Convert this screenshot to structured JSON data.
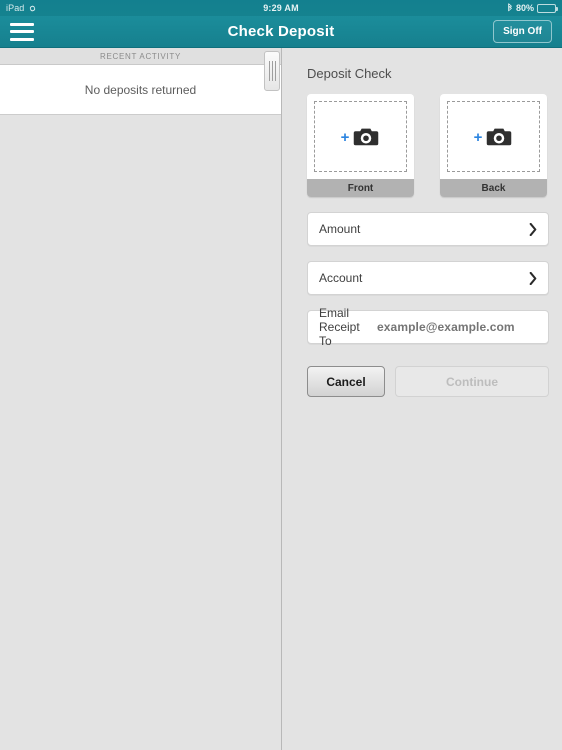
{
  "statusbar": {
    "device_label": "iPad",
    "sync_icon": "sync-icon",
    "time": "9:29 AM",
    "bluetooth_icon": "bluetooth-icon",
    "battery_percent": "80%",
    "battery_level": 80
  },
  "navbar": {
    "menu_icon": "hamburger-menu-icon",
    "title": "Check Deposit",
    "signoff_label": "Sign Off"
  },
  "left_panel": {
    "section_header": "RECENT ACTIVITY",
    "empty_message": "No deposits returned"
  },
  "right_panel": {
    "title": "Deposit Check",
    "captures": [
      {
        "label": "Front",
        "plus": "+",
        "icon": "camera-icon"
      },
      {
        "label": "Back",
        "plus": "+",
        "icon": "camera-icon"
      }
    ],
    "fields": [
      {
        "label": "Amount",
        "chevron": "chevron-right-icon"
      },
      {
        "label": "Account",
        "chevron": "chevron-right-icon"
      }
    ],
    "email": {
      "label": "Email Receipt To",
      "value": "",
      "placeholder": "example@example.com"
    },
    "buttons": {
      "cancel_label": "Cancel",
      "continue_label": "Continue",
      "continue_disabled": true
    }
  },
  "colors": {
    "brand_teal": "#16808e",
    "accent_blue": "#2b84e0",
    "panel_gray": "#e3e3e3",
    "footer_gray": "#b2b2b2"
  }
}
